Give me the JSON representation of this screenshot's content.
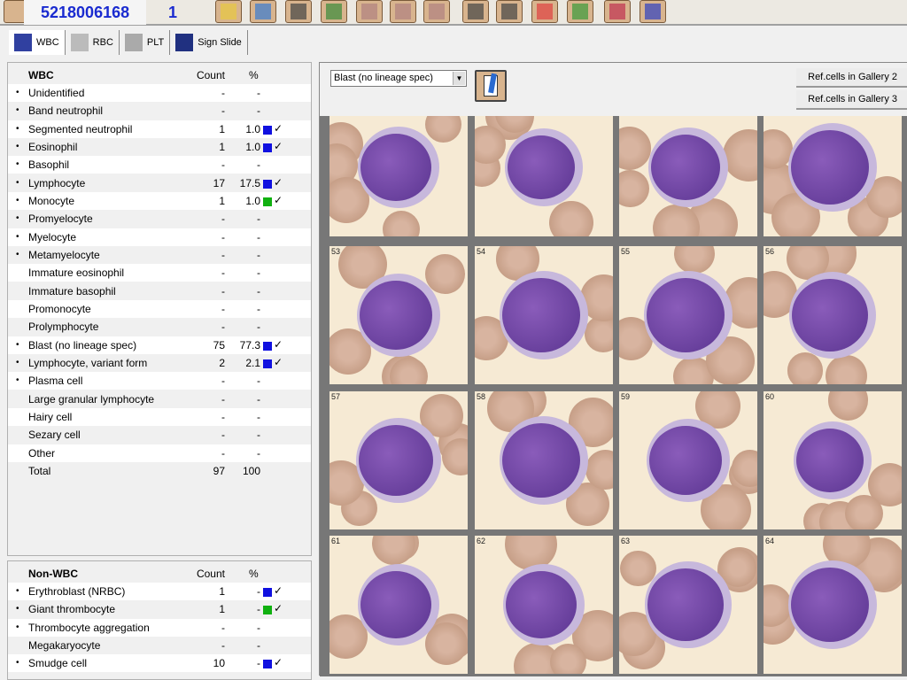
{
  "header": {
    "sample_id": "5218006168",
    "run_number": "1"
  },
  "toolbar_icons": [
    "report-icon",
    "open-folder-icon",
    "patient-info-icon",
    "chart-check-icon",
    "monitor-icon",
    "grid-layout-6-icon",
    "grid-layout-4-icon",
    "grid-layout-3-icon",
    "zoom-in-icon",
    "zoom-out-icon",
    "color-palette-icon",
    "color-adjust-icon",
    "cells-icon",
    "page-1-icon"
  ],
  "tabs": [
    {
      "label": "WBC",
      "icon": "wbc-icon"
    },
    {
      "label": "RBC",
      "icon": "rbc-icon"
    },
    {
      "label": "PLT",
      "icon": "plt-icon"
    },
    {
      "label": "Sign Slide",
      "icon": "bar-chart-icon"
    }
  ],
  "wbc": {
    "title": "WBC",
    "count_header": "Count",
    "pct_header": "%",
    "rows": [
      {
        "label": "Unidentified",
        "count": "-",
        "pct": "-",
        "bullet": true
      },
      {
        "label": "Band neutrophil",
        "count": "-",
        "pct": "-",
        "bullet": true
      },
      {
        "label": "Segmented neutrophil",
        "count": "1",
        "pct": "1.0",
        "bullet": true,
        "marker": "#1010e0",
        "check": "✓"
      },
      {
        "label": "Eosinophil",
        "count": "1",
        "pct": "1.0",
        "bullet": true,
        "marker": "#1010e0",
        "check": "✓"
      },
      {
        "label": "Basophil",
        "count": "-",
        "pct": "-",
        "bullet": true
      },
      {
        "label": "Lymphocyte",
        "count": "17",
        "pct": "17.5",
        "bullet": true,
        "marker": "#1010e0",
        "check": "✓"
      },
      {
        "label": "Monocyte",
        "count": "1",
        "pct": "1.0",
        "bullet": true,
        "marker": "#10b010",
        "check": "✓"
      },
      {
        "label": "Promyelocyte",
        "count": "-",
        "pct": "-",
        "bullet": true
      },
      {
        "label": "Myelocyte",
        "count": "-",
        "pct": "-",
        "bullet": true
      },
      {
        "label": "Metamyelocyte",
        "count": "-",
        "pct": "-",
        "bullet": true
      },
      {
        "label": "Immature eosinophil",
        "count": "-",
        "pct": "-"
      },
      {
        "label": "Immature basophil",
        "count": "-",
        "pct": "-"
      },
      {
        "label": "Promonocyte",
        "count": "-",
        "pct": "-"
      },
      {
        "label": "Prolymphocyte",
        "count": "-",
        "pct": "-"
      },
      {
        "label": "Blast (no lineage spec)",
        "count": "75",
        "pct": "77.3",
        "bullet": true,
        "marker": "#1010e0",
        "check": "✓"
      },
      {
        "label": "Lymphocyte, variant form",
        "count": "2",
        "pct": "2.1",
        "bullet": true,
        "marker": "#1010e0",
        "check": "✓"
      },
      {
        "label": "Plasma cell",
        "count": "-",
        "pct": "-",
        "bullet": true
      },
      {
        "label": "Large granular lymphocyte",
        "count": "-",
        "pct": "-"
      },
      {
        "label": "Hairy cell",
        "count": "-",
        "pct": "-"
      },
      {
        "label": "Sezary cell",
        "count": "-",
        "pct": "-"
      },
      {
        "label": "Other",
        "count": "-",
        "pct": "-"
      },
      {
        "label": "Total",
        "count": "97",
        "pct": "100"
      }
    ]
  },
  "nonwbc": {
    "title": "Non-WBC",
    "count_header": "Count",
    "pct_header": "%",
    "rows": [
      {
        "label": "Erythroblast (NRBC)",
        "count": "1",
        "pct": "-",
        "bullet": true,
        "marker": "#1010e0",
        "check": "✓"
      },
      {
        "label": "Giant thrombocyte",
        "count": "1",
        "pct": "-",
        "bullet": true,
        "marker": "#10b010",
        "check": "✓"
      },
      {
        "label": "Thrombocyte aggregation",
        "count": "-",
        "pct": "-",
        "bullet": true
      },
      {
        "label": "Megakaryocyte",
        "count": "-",
        "pct": "-"
      },
      {
        "label": "Smudge cell",
        "count": "10",
        "pct": "-",
        "bullet": true,
        "marker": "#1010e0",
        "check": "✓"
      }
    ]
  },
  "gallery": {
    "class_select": "Blast (no lineage spec)",
    "ref_gallery_2": "Ref.cells in Gallery 2",
    "ref_gallery_3": "Ref.cells in Gallery 3",
    "tiles": [
      "",
      "",
      "",
      "",
      "53",
      "54",
      "55",
      "56",
      "57",
      "58",
      "59",
      "60",
      "61",
      "62",
      "63",
      "64"
    ]
  }
}
